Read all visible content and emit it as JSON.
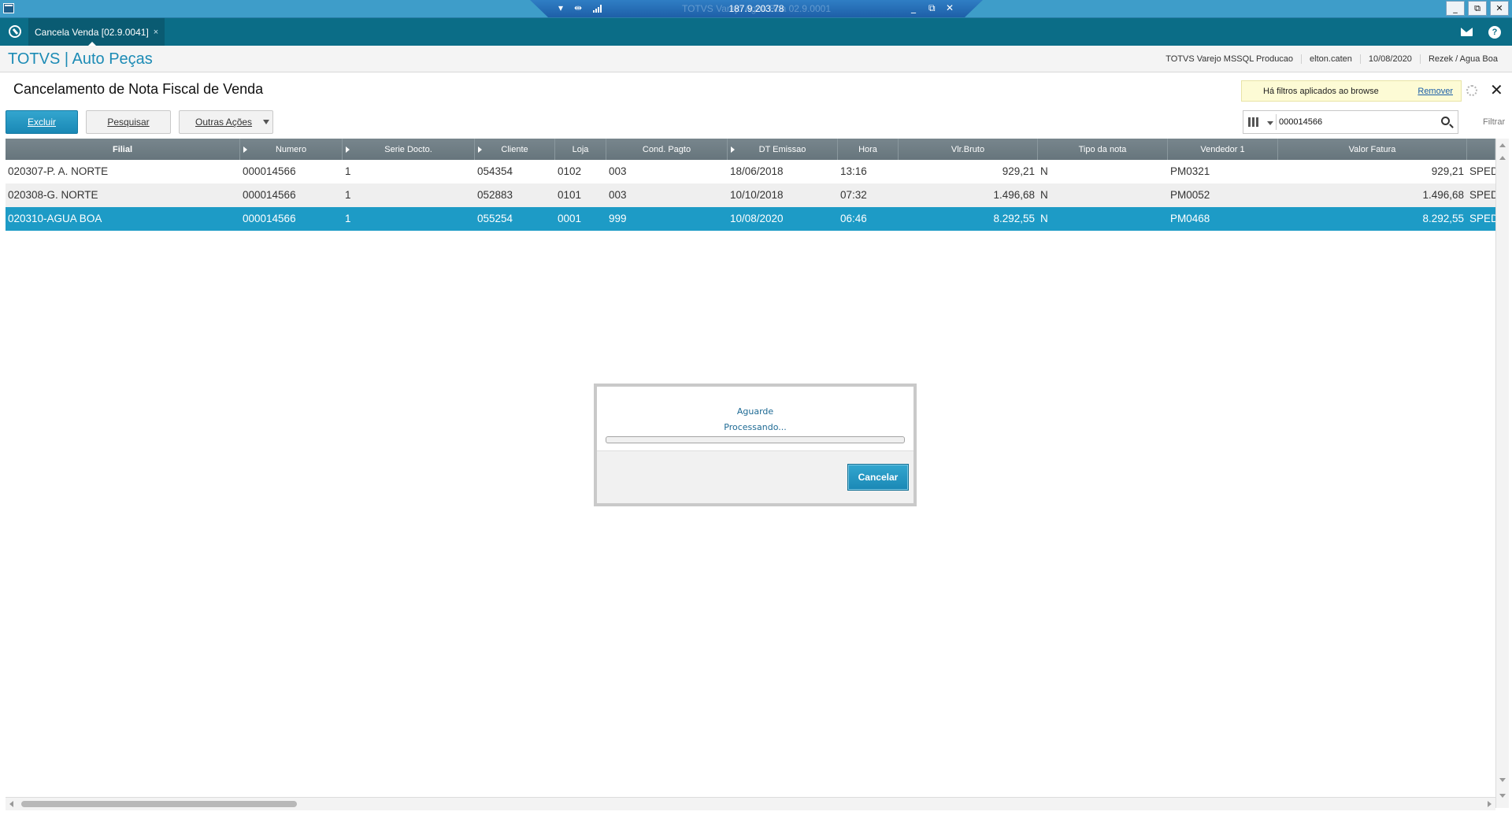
{
  "remote_session": {
    "title": "TOTVS Varejo Agua Boa 02.9.0001",
    "ip": "187.9.203.78"
  },
  "tabs": [
    {
      "label": "Cancela Venda [02.9.0041]",
      "close": "×"
    }
  ],
  "brand": "TOTVS | Auto Peças",
  "header": {
    "environment": "TOTVS Varejo MSSQL Producao",
    "user": "elton.caten",
    "date": "10/08/2020",
    "company": "Rezek / Agua Boa"
  },
  "page": {
    "title": "Cancelamento de Nota Fiscal de Venda",
    "filter_notice": "Há filtros aplicados ao browse",
    "filter_remove": "Remover",
    "filter_label": "Filtrar"
  },
  "actions": {
    "delete": "Excluir",
    "search": "Pesquisar",
    "more": "Outras Ações"
  },
  "search": {
    "value": "000014566"
  },
  "grid": {
    "columns": [
      "Filial",
      "Numero",
      "Serie Docto.",
      "Cliente",
      "Loja",
      "Cond. Pagto",
      "DT Emissao",
      "Hora",
      "Vlr.Bruto",
      "Tipo da nota",
      "Vendedor 1",
      "Valor Fatura",
      ""
    ],
    "rows": [
      [
        "020307-P. A. NORTE",
        "000014566",
        "1",
        "054354",
        "0102",
        "003",
        "18/06/2018",
        "13:16",
        "929,21",
        "N",
        "PM0321",
        "929,21",
        "SPED"
      ],
      [
        "020308-G. NORTE",
        "000014566",
        "1",
        "052883",
        "0101",
        "003",
        "10/10/2018",
        "07:32",
        "1.496,68",
        "N",
        "PM0052",
        "1.496,68",
        "SPED"
      ],
      [
        "020310-AGUA BOA",
        "000014566",
        "1",
        "055254",
        "0001",
        "999",
        "10/08/2020",
        "06:46",
        "8.292,55",
        "N",
        "PM0468",
        "8.292,55",
        "SPED"
      ]
    ],
    "selected_row": 2
  },
  "modal": {
    "title": "Aguarde",
    "message": "Processando...",
    "progress": 0,
    "cancel": "Cancelar"
  }
}
